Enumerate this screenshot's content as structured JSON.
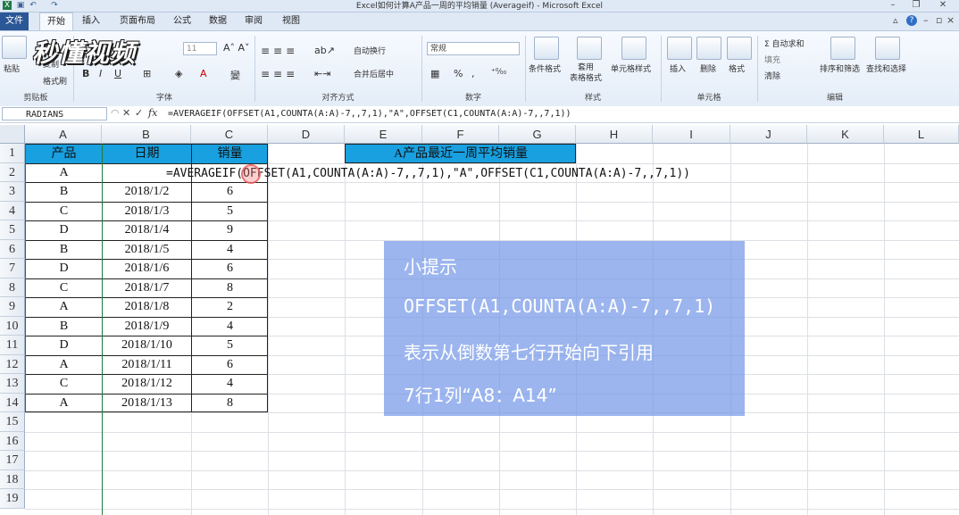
{
  "window": {
    "title": "Excel如何计算A产品一周的平均销量 (Averageif)   - Microsoft Excel"
  },
  "ribbon": {
    "tabs": [
      "文件",
      "开始",
      "插入",
      "页面布局",
      "公式",
      "数据",
      "审阅",
      "视图"
    ],
    "clipboard": {
      "paste": "粘贴",
      "copy": "复制",
      "format_painter": "格式刷",
      "group": "剪贴板"
    },
    "font": {
      "size": "11",
      "group": "字体"
    },
    "alignment": {
      "wrap": "自动换行",
      "merge": "合并后居中",
      "group": "对齐方式"
    },
    "number": {
      "format": "常规",
      "percent": "%",
      "comma": ",",
      "group": "数字"
    },
    "styles": {
      "conditional": "条件格式",
      "table": "套用\n表格格式",
      "cell_styles": "单元格样式",
      "group": "样式"
    },
    "cells": {
      "insert": "插入",
      "delete": "删除",
      "format": "格式",
      "group": "单元格"
    },
    "editing": {
      "autosum": "Σ 自动求和",
      "fill": "填充",
      "clear": "清除",
      "sort": "排序和筛选",
      "find": "查找和选择",
      "group": "编辑"
    }
  },
  "watermark": "秒懂视频",
  "formula_bar": {
    "name_box": "RADIANS",
    "fx": "fx",
    "formula": "=AVERAGEIF(OFFSET(A1,COUNTA(A:A)-7,,7,1),\"A\",OFFSET(C1,COUNTA(A:A)-7,,7,1))"
  },
  "grid": {
    "columns": [
      "A",
      "B",
      "C",
      "D",
      "E",
      "F",
      "G",
      "H",
      "I",
      "J",
      "K",
      "L"
    ],
    "rows": [
      "1",
      "2",
      "3",
      "4",
      "5",
      "6",
      "7",
      "8",
      "9",
      "10",
      "11",
      "12",
      "13",
      "14",
      "15",
      "16",
      "17",
      "18",
      "19"
    ],
    "headers": {
      "product": "产品",
      "date": "日期",
      "sales": "销量",
      "avg_title": "A产品最近一周平均销量"
    },
    "data": [
      {
        "product": "A",
        "date": "",
        "sales": ""
      },
      {
        "product": "B",
        "date": "2018/1/2",
        "sales": "6"
      },
      {
        "product": "C",
        "date": "2018/1/3",
        "sales": "5"
      },
      {
        "product": "D",
        "date": "2018/1/4",
        "sales": "9"
      },
      {
        "product": "B",
        "date": "2018/1/5",
        "sales": "4"
      },
      {
        "product": "D",
        "date": "2018/1/6",
        "sales": "6"
      },
      {
        "product": "C",
        "date": "2018/1/7",
        "sales": "8"
      },
      {
        "product": "A",
        "date": "2018/1/8",
        "sales": "2"
      },
      {
        "product": "B",
        "date": "2018/1/9",
        "sales": "4"
      },
      {
        "product": "D",
        "date": "2018/1/10",
        "sales": "5"
      },
      {
        "product": "A",
        "date": "2018/1/11",
        "sales": "6"
      },
      {
        "product": "C",
        "date": "2018/1/12",
        "sales": "4"
      },
      {
        "product": "A",
        "date": "2018/1/13",
        "sales": "8"
      }
    ],
    "editing_formula": "=AVERAGEIF(OFFSET(A1,COUNTA(A:A)-7,,7,1),\"A\",OFFSET(C1,COUNTA(A:A)-7,,7,1))"
  },
  "tip": {
    "title": "小提示",
    "line1": "OFFSET(A1,COUNTA(A:A)-7,,7,1)",
    "line2": "表示从倒数第七行开始向下引用",
    "line3": "7行1列“A8：A14”"
  },
  "colors": {
    "header_fill": "#18a0e0",
    "tip_fill": "#7698e8",
    "file_tab": "#2b5797"
  },
  "icons": [
    "excel-icon",
    "save-icon",
    "undo-icon",
    "redo-icon",
    "minimize-icon",
    "restore-icon",
    "close-icon",
    "help-icon",
    "paste-icon",
    "cancel-icon",
    "enter-icon",
    "function-icon"
  ]
}
